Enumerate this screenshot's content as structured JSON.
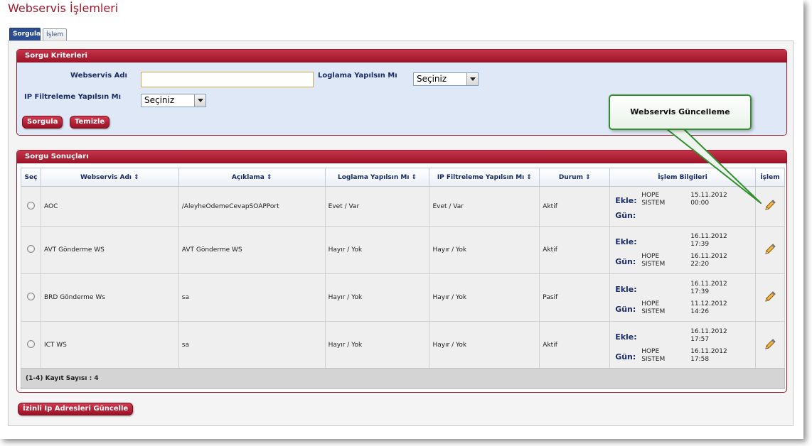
{
  "page": {
    "title": "Webservis İşlemleri"
  },
  "tabs": [
    {
      "label": "Sorgula",
      "active": true
    },
    {
      "label": "İşlem",
      "active": false
    }
  ],
  "criteria": {
    "header": "Sorgu Kriterleri",
    "webservis_adi_label": "Webservis Adı",
    "webservis_adi_value": "",
    "loglama_label": "Loglama Yapılsın Mı",
    "loglama_value": "Seçiniz",
    "ip_filtreleme_label": "IP Filtreleme Yapılsın Mı",
    "ip_filtreleme_value": "Seçiniz",
    "sorgula_button": "Sorgula",
    "temizle_button": "Temizle"
  },
  "callout": {
    "text": "Webservis Güncelleme"
  },
  "results": {
    "header": "Sorgu Sonuçları",
    "columns": {
      "sec": "Seç",
      "ad": "Webservis Adı ⇕",
      "aciklama": "Açıklama ⇕",
      "loglama": "Loglama Yapılsın Mı ⇕",
      "ip": "IP Filtreleme Yapılsın Mı ⇕",
      "durum": "Durum ⇕",
      "bilgi": "İşlem Bilgileri",
      "islem": "İşlem"
    },
    "info_labels": {
      "ekle": "Ekle:",
      "gun": "Gün:"
    },
    "rows": [
      {
        "ad": "AOC",
        "aciklama": "/AleyheOdemeCevapSOAPPort",
        "loglama": "Evet / Var",
        "ip": "Evet / Var",
        "durum": "Aktif",
        "ekle_user_1": "HOPE",
        "ekle_user_2": "SISTEM",
        "ekle_date": "15.11.2012",
        "ekle_time": "00:00",
        "gun_user_1": "",
        "gun_user_2": "",
        "gun_date": "",
        "gun_time": ""
      },
      {
        "ad": "AVT Gönderme WS",
        "aciklama": "AVT Gönderme WS",
        "loglama": "Hayır / Yok",
        "ip": "Hayır / Yok",
        "durum": "Aktif",
        "ekle_user_1": "",
        "ekle_user_2": "",
        "ekle_date": "16.11.2012",
        "ekle_time": "17:39",
        "gun_user_1": "HOPE",
        "gun_user_2": "SISTEM",
        "gun_date": "16.11.2012",
        "gun_time": "22:20"
      },
      {
        "ad": "BRD Gönderme Ws",
        "aciklama": "sa",
        "loglama": "Hayır / Yok",
        "ip": "Hayır / Yok",
        "durum": "Pasif",
        "ekle_user_1": "",
        "ekle_user_2": "",
        "ekle_date": "16.11.2012",
        "ekle_time": "17:39",
        "gun_user_1": "HOPE",
        "gun_user_2": "SISTEM",
        "gun_date": "11.12.2012",
        "gun_time": "14:26"
      },
      {
        "ad": "ICT WS",
        "aciklama": "sa",
        "loglama": "Hayır / Yok",
        "ip": "Hayır / Yok",
        "durum": "Aktif",
        "ekle_user_1": "",
        "ekle_user_2": "",
        "ekle_date": "16.11.2012",
        "ekle_time": "17:57",
        "gun_user_1": "HOPE",
        "gun_user_2": "SISTEM",
        "gun_date": "16.11.2012",
        "gun_time": "17:58"
      }
    ],
    "record_count": "(1-4) Kayıt Sayısı : 4"
  },
  "bottom": {
    "ip_update_button": "İzinli Ip Adresleri Güncelle"
  },
  "colors": {
    "accent_red": "#a3192b",
    "navy": "#1a2b66",
    "criteria_bg": "#dfe8f6",
    "callout_green": "#2f8f2f"
  },
  "icons": {
    "edit": "pencil-icon",
    "select": "radio-button"
  }
}
